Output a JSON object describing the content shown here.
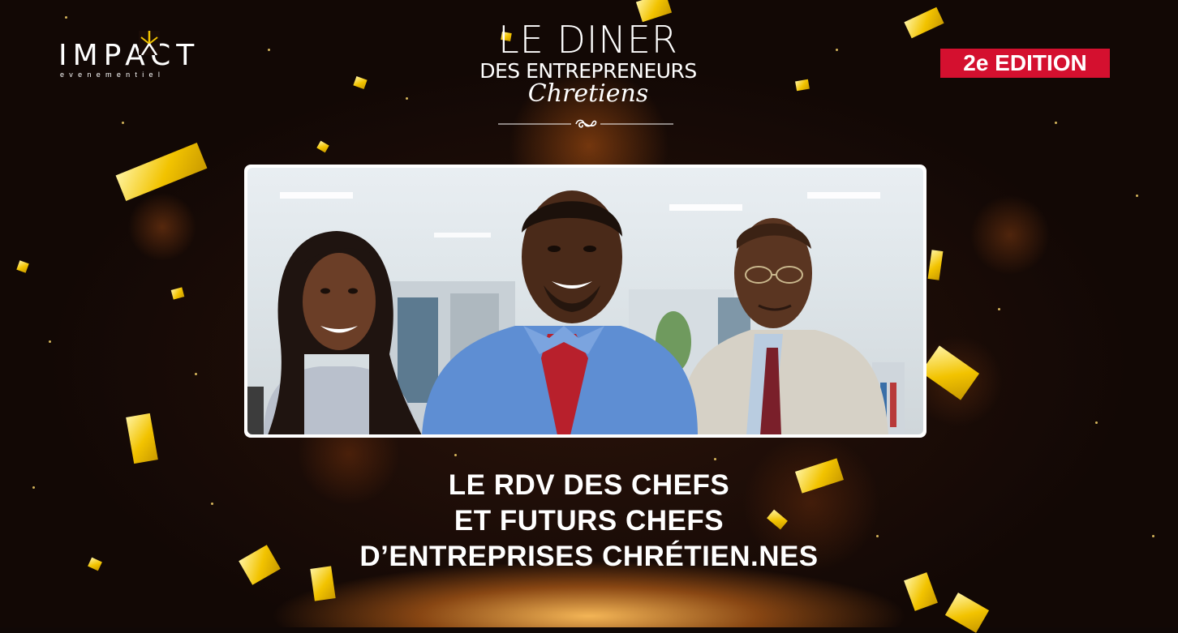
{
  "logo": {
    "name": "IMPACT",
    "tagline": "evenementiel"
  },
  "event_title": {
    "line1": "LE DINER",
    "line2": "DES ENTREPRENEURS",
    "line3": "Chretiens"
  },
  "edition_badge": "2e EDITION",
  "headline": [
    "LE RDV DES CHEFS",
    "ET FUTURS CHEFS",
    "D’ENTREPRISES CHRÉTIEN.NES"
  ],
  "colors": {
    "badge": "#d4102f",
    "confetti": "#f2c300",
    "background": "#120805"
  },
  "icons": [
    "impact-star-logo-icon",
    "ornament-flourish-icon"
  ]
}
